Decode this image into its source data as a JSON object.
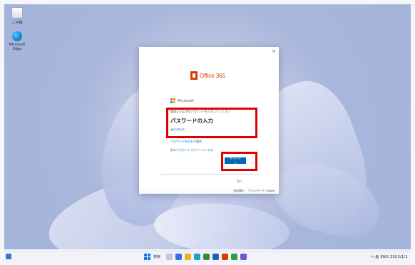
{
  "desktop": {
    "icons": [
      {
        "name": "recycle-bin-icon",
        "label": "ごみ箱"
      },
      {
        "name": "edge-icon",
        "label": "Microsoft Edge"
      }
    ]
  },
  "dialog": {
    "close": "×",
    "brand": "Office 365",
    "ms_text": "Microsoft",
    "prompt_label": "職場または学校アカウントを入力してください",
    "heading": "パスワードの入力",
    "account_id": "@contoso",
    "link1": "パスワードを忘れた場合",
    "link2": "別のアカウントでサインインする",
    "signin_button": "サインイン",
    "footer": "次へ",
    "bottom": [
      "利用規約",
      "プライバシーと Cookie"
    ]
  },
  "taskbar": {
    "search": "検索",
    "clock": "へ 画 ENG 2023/1/1"
  },
  "colors": {
    "accent": "#0067b8",
    "office_brand": "#d83b01",
    "highlight": "#e00000"
  }
}
